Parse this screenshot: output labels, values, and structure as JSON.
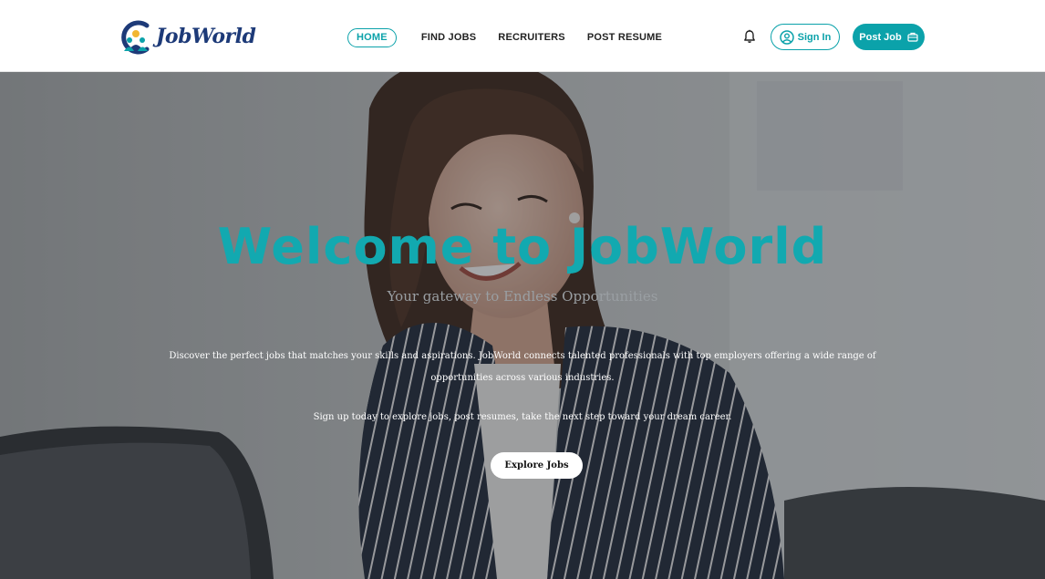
{
  "brand": {
    "name": "JobWorld",
    "primary_color": "#0ba2aa",
    "logo_text_color": "#1d3a78"
  },
  "nav": {
    "items": [
      {
        "label": "HOME",
        "active": true
      },
      {
        "label": "FIND JOBS",
        "active": false
      },
      {
        "label": "RECRUITERS",
        "active": false
      },
      {
        "label": "POST RESUME",
        "active": false
      }
    ]
  },
  "actions": {
    "notification_icon": "bell-icon",
    "sign_in_label": "Sign In",
    "sign_in_icon": "user-circle-icon",
    "post_job_label": "Post Job",
    "post_job_icon": "briefcase-icon"
  },
  "hero": {
    "title": "Welcome to JobWorld",
    "subtitle": "Your gateway to Endless Opportunities",
    "description": "Discover the perfect jobs that matches your skills and aspirations. JobWorld connects talented professionals with top employers offering a wide range of opportunities across various industries.",
    "signup_text": "Sign up today to explore jobs, post resumes, take the next step toward your dream career.",
    "cta_label": "Explore Jobs",
    "background_image": "smiling woman in striped blazer working at laptop"
  }
}
